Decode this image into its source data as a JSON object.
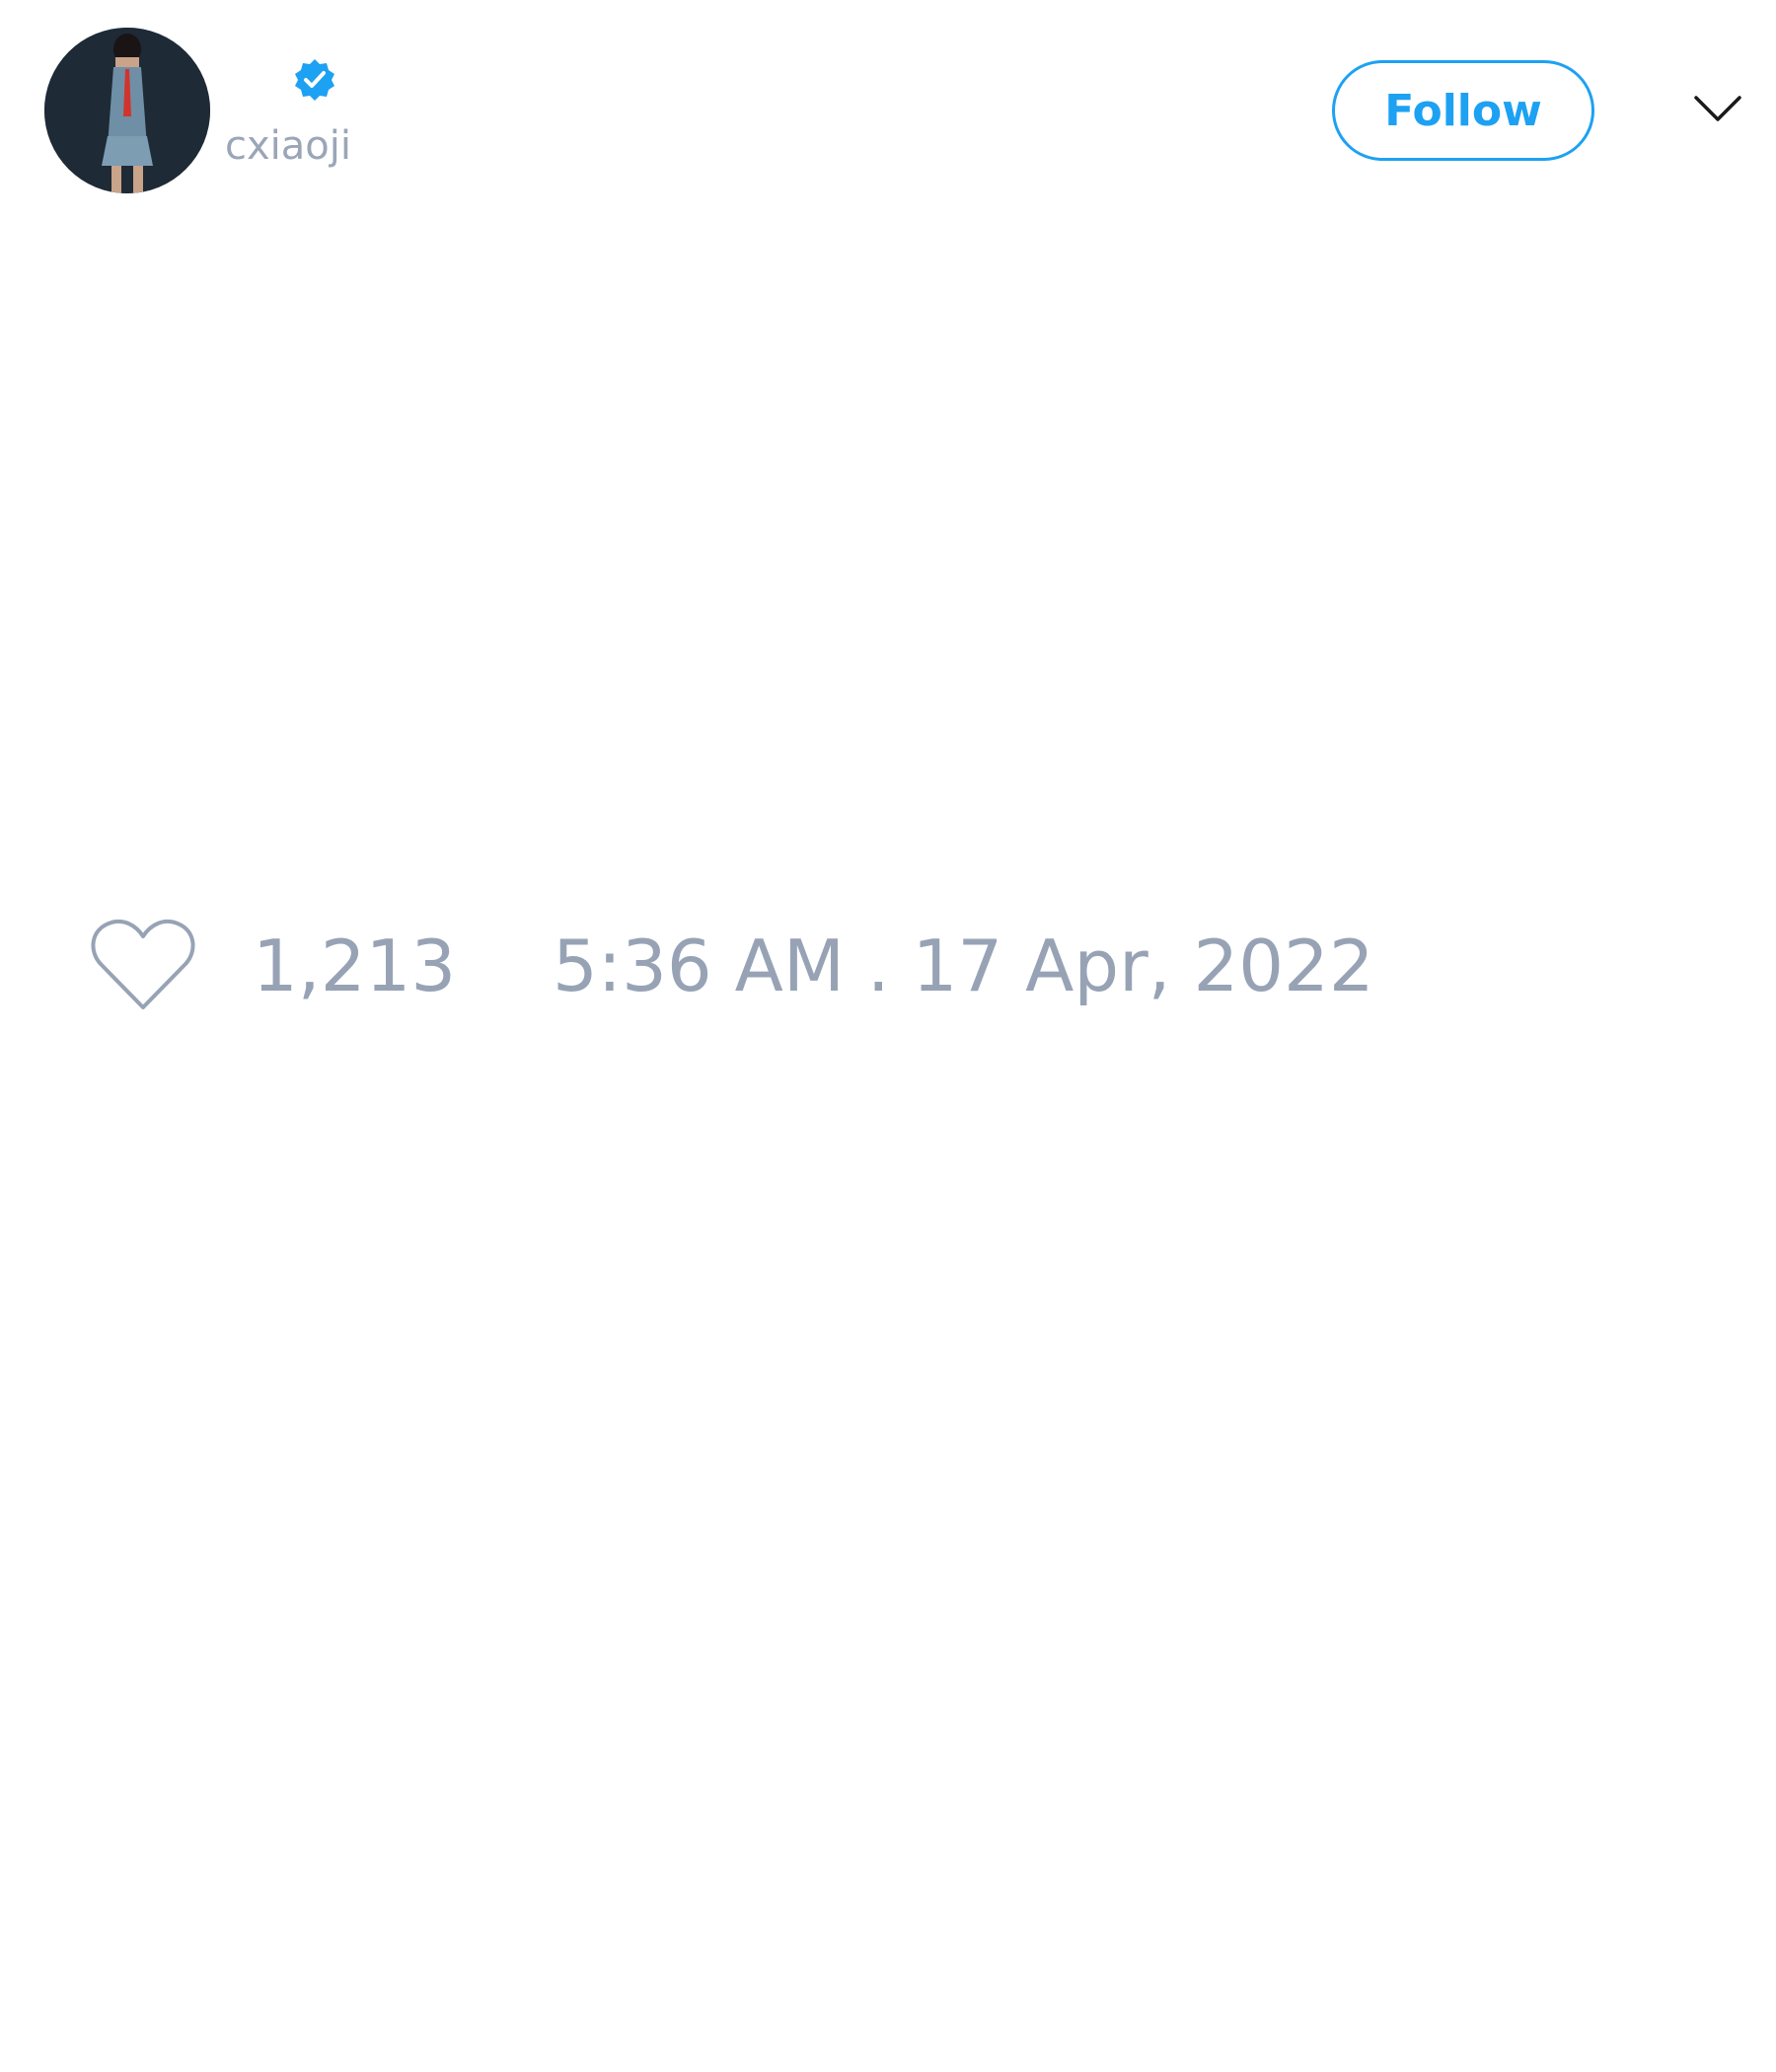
{
  "header": {
    "avatar_icon": "avatar-photo",
    "verified_icon": "verified-badge-icon",
    "handle": "cxiaoji",
    "follow_label": "Follow",
    "menu_icon": "chevron-down-icon"
  },
  "footer": {
    "like_icon": "heart-icon",
    "like_count": "1,213",
    "timestamp": "5:36 AM . 17 Apr, 2022"
  },
  "colors": {
    "accent": "#1da1f2",
    "muted_text": "#97a3b5",
    "background": "#ffffff"
  }
}
